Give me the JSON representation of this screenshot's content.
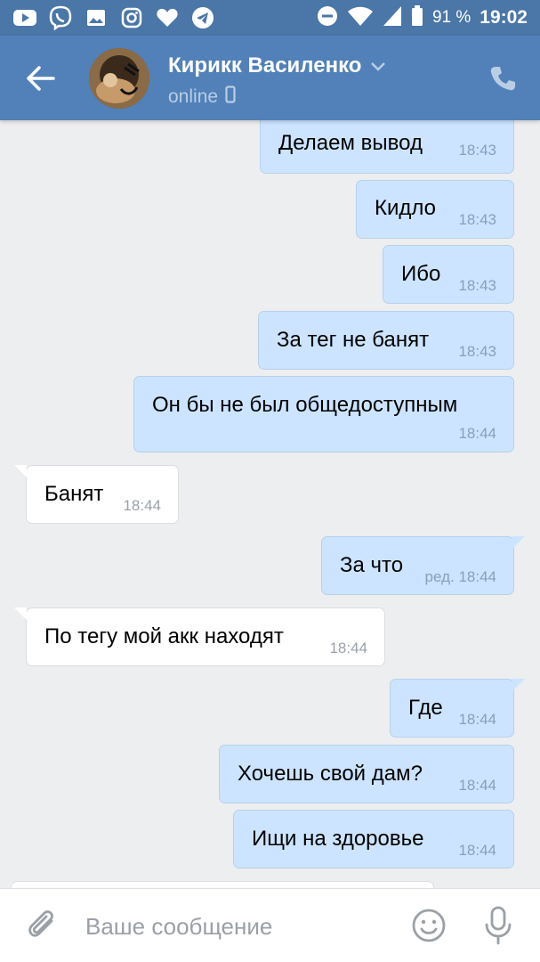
{
  "status_bar": {
    "icons": [
      "youtube-icon",
      "viber-icon",
      "gallery-icon",
      "instagram-icon",
      "heart-icon",
      "telegram-icon"
    ],
    "right_icons": [
      "do-not-disturb-icon",
      "wifi-icon",
      "signal-icon",
      "battery-icon"
    ],
    "battery": "91 %",
    "time": "19:02"
  },
  "header": {
    "name": "Кирикк Василенко",
    "status": "online"
  },
  "messages": [
    {
      "dir": "out",
      "text": "Делаем вывод",
      "time": "18:43"
    },
    {
      "dir": "out",
      "text": "Кидло",
      "time": "18:43"
    },
    {
      "dir": "out",
      "text": "Ибо",
      "time": "18:43"
    },
    {
      "dir": "out",
      "text": "За тег не банят",
      "time": "18:43"
    },
    {
      "dir": "out",
      "text": "Он бы не был общедоступным",
      "time": "18:44"
    },
    {
      "dir": "in",
      "text": "Банят",
      "time": "18:44"
    },
    {
      "dir": "out",
      "text": "За что",
      "time": "ред. 18:44"
    },
    {
      "dir": "in",
      "text": "По тегу мой акк находят",
      "time": "18:44"
    },
    {
      "dir": "out",
      "text": "Где",
      "time": "18:44"
    },
    {
      "dir": "out",
      "text": "Хочешь свой дам?",
      "time": "18:44"
    },
    {
      "dir": "out",
      "text": "Ищи на здоровье",
      "time": "18:44"
    }
  ],
  "input": {
    "placeholder": "Ваше сообщение",
    "value": ""
  },
  "colors": {
    "header": "#5181b8",
    "status_bar": "#4a76a8",
    "background": "#edeef0",
    "outgoing_bubble": "#cce4ff",
    "incoming_bubble": "#ffffff"
  }
}
